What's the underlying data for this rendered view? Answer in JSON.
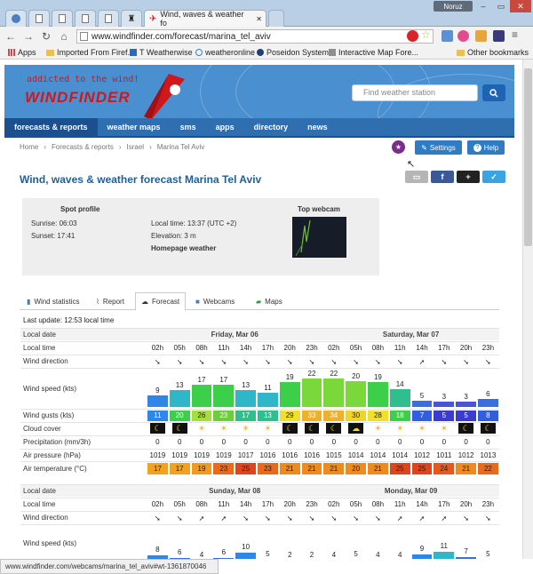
{
  "browser": {
    "active_tab_title": "Wind, waves & weather fo",
    "user": "Noruz",
    "address": "www.windfinder.com/forecast/marina_tel_aviv",
    "window_controls": [
      "–",
      "▭",
      "✕"
    ],
    "bookmarks": [
      "Apps",
      "Imported From Firef...",
      "T Weatherwise",
      "weatheronline",
      "Poseidon System",
      "Interactive Map Fore...",
      "Other bookmarks"
    ]
  },
  "site": {
    "tagline": "addicted to the wind!",
    "logo": "WINDFINDER",
    "search_placeholder": "Find weather station",
    "nav": [
      "forecasts & reports",
      "weather maps",
      "sms",
      "apps",
      "directory",
      "news"
    ],
    "breadcrumb": [
      "Home",
      "Forecasts & reports",
      "Israel",
      "Marina Tel Aviv"
    ],
    "settings_label": "Settings",
    "help_label": "Help",
    "page_title": "Wind, waves & weather forecast Marina Tel Aviv"
  },
  "spot": {
    "heading": "Spot profile",
    "sunrise": "Sunrise: 06:03",
    "sunset": "Sunset: 17:41",
    "local_time": "Local time: 13:37 (UTC +2)",
    "elevation": "Elevation: 3 m",
    "homepage": "Homepage weather",
    "webcam_heading": "Top webcam"
  },
  "tabs": [
    "Wind statistics",
    "Report",
    "Forecast",
    "Webcams",
    "Maps"
  ],
  "last_update": "Last update: 12:53 local time",
  "row_labels": {
    "date": "Local date",
    "time": "Local time",
    "direction": "Wind direction",
    "speed": "Wind speed (kts)",
    "gusts": "Wind gusts (kts)",
    "cloud": "Cloud cover",
    "precip": "Precipitation (mm/3h)",
    "pressure": "Air pressure (hPa)",
    "temp": "Air temperature (°C)"
  },
  "days": [
    "Friday, Mar 06",
    "Saturday, Mar 07",
    "Sunday, Mar 08",
    "Monday, Mar 09"
  ],
  "hours": [
    "02h",
    "05h",
    "08h",
    "11h",
    "14h",
    "17h",
    "20h",
    "23h",
    "02h",
    "05h",
    "08h",
    "11h",
    "14h",
    "17h",
    "20h",
    "23h"
  ],
  "forecast1": {
    "directions": [
      "➘",
      "➘",
      "➘",
      "➘",
      "➘",
      "➘",
      "➘",
      "➘",
      "➘",
      "➘",
      "➘",
      "➘",
      "➚",
      "➘",
      "➘",
      "➘"
    ],
    "speed": [
      9,
      13,
      17,
      17,
      13,
      11,
      19,
      22,
      22,
      20,
      19,
      14,
      5,
      3,
      3,
      6
    ],
    "gusts": [
      11,
      20,
      26,
      23,
      17,
      13,
      29,
      33,
      34,
      30,
      28,
      18,
      7,
      5,
      5,
      8
    ],
    "cloud": [
      "☾",
      "☾",
      "☀",
      "☀",
      "☀",
      "☀",
      "☾",
      "☾",
      "☾",
      "☁",
      "☀",
      "☀",
      "☀",
      "☀",
      "☾",
      "☾"
    ],
    "precip": [
      0,
      0,
      0,
      0,
      0,
      0,
      0,
      0,
      0,
      0,
      0,
      0,
      0,
      0,
      0,
      0
    ],
    "pressure": [
      1019,
      1019,
      1019,
      1019,
      1017,
      1016,
      1016,
      1016,
      1015,
      1014,
      1014,
      1014,
      1012,
      1011,
      1012,
      1013
    ],
    "temp": [
      17,
      17,
      19,
      23,
      25,
      23,
      21,
      21,
      21,
      20,
      21,
      25,
      25,
      24,
      21,
      22
    ]
  },
  "forecast2": {
    "directions": [
      "➘",
      "➘",
      "➚",
      "➚",
      "➘",
      "➘",
      "➘",
      "➘",
      "➘",
      "➘",
      "➘",
      "➚",
      "➚",
      "➚",
      "➘",
      "➘"
    ],
    "speed": [
      8,
      6,
      4,
      6,
      10,
      5,
      2,
      2,
      4,
      5,
      4,
      4,
      9,
      11,
      7,
      5
    ]
  },
  "status_url": "www.windfinder.com/webcams/marina_tel_aviv#wt-1361870046",
  "colors": {
    "brand_red": "#d0171b",
    "header_blue": "#4a8fcf",
    "nav_blue": "#2f6fb0",
    "title_blue": "#1f5f99"
  }
}
